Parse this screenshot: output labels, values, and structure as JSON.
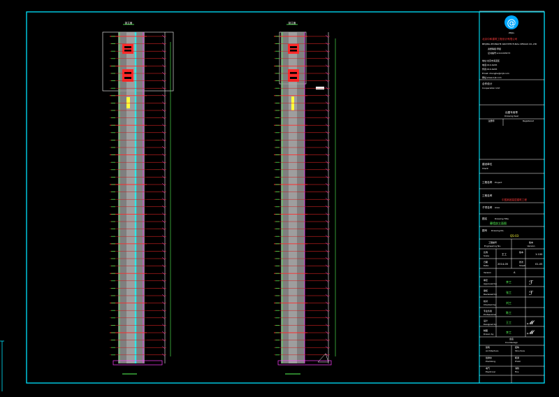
{
  "elevations": [
    {
      "title": "剖立面"
    },
    {
      "title": "剖立面"
    }
  ],
  "company": {
    "logo_caption": "ZRJLL",
    "name_cn": "北京中和建筑工程设计有限公司",
    "name_en": "BEIJING ZHONGHE ARCHITECTURAL DESIGN CO.,LTD",
    "certificate_label": "资质等级:甲级",
    "certificate_no": "证书编号:A111003473",
    "address": "地址:北京市海淀区",
    "tel": "电话:010-6245",
    "fax": "传真:010-6245",
    "email": "Email: zhonghe@zrjll.com",
    "web": "网址:www.zrjll.com"
  },
  "title_block": {
    "consultant_label": "合作设计",
    "consultant_en": "Cooperation Unit",
    "seal_label": "出图专用章",
    "seal_en": "Drawing Seal",
    "stamp_label": "注册师",
    "stamp_en": "Registered",
    "client_label": "建设单位",
    "client_en": "Client",
    "project_label": "工程名称",
    "project_en": "Project",
    "project_name": "中国某超高层建筑工程",
    "area_label": "子项名称",
    "area_en": "Area",
    "drawing_label": "图名",
    "drawing_en": "Drawing Title",
    "drawing_title": "幕墙剖立面图",
    "drawing_no_label": "图号",
    "drawing_no_en": "Drawing No.",
    "drawing_no": "QS-03",
    "engineering_no_label": "工程编号",
    "engineering_no_en": "Engineering No.",
    "scale_label": "比例",
    "scale_en": "Scale",
    "scale_value": "1:100",
    "version_label": "版本",
    "version_en": "Version",
    "version_value": "A",
    "date_label": "日期",
    "date_en": "Date",
    "date_value": "2014-05",
    "sheet_label": "张次",
    "sheet_en": "Sheet",
    "sheet_value": "01-05",
    "approved_label": "审定",
    "approved_en": "Approved by",
    "reviewed_label": "审核",
    "reviewed_en": "Reviewed by",
    "checked_label": "校对",
    "checked_en": "Checked by",
    "professional_label": "专业负责",
    "professional_en": "Professional",
    "designed_label": "设计",
    "designed_en": "Designed by",
    "drawn_label": "制图",
    "drawn_en": "Drawn by",
    "countersign_label": "会签",
    "countersign_en": "Countersign",
    "arch_label": "建筑",
    "arch_en": "Architecture",
    "struct_label": "结构",
    "struct_en": "Structure",
    "plumb_label": "给排水",
    "plumb_en": "Plumbing",
    "hvac_label": "暖通",
    "hvac_en": "HVAC",
    "elec_label": "电气",
    "elec_en": "Electrical",
    "fire_label": "消防",
    "fire_en": "Fire",
    "name_1": "王工",
    "name_2": "李工",
    "name_3": "张工",
    "name_4": "刘工",
    "name_5": "陈工"
  },
  "colors": {
    "frame": "#00e5ff",
    "red": "#ff2a2a",
    "green": "#59ff59",
    "magenta": "#ff40ff",
    "yellow": "#ffff3c",
    "cyan": "#2fe7e7",
    "white": "#ffffff"
  }
}
